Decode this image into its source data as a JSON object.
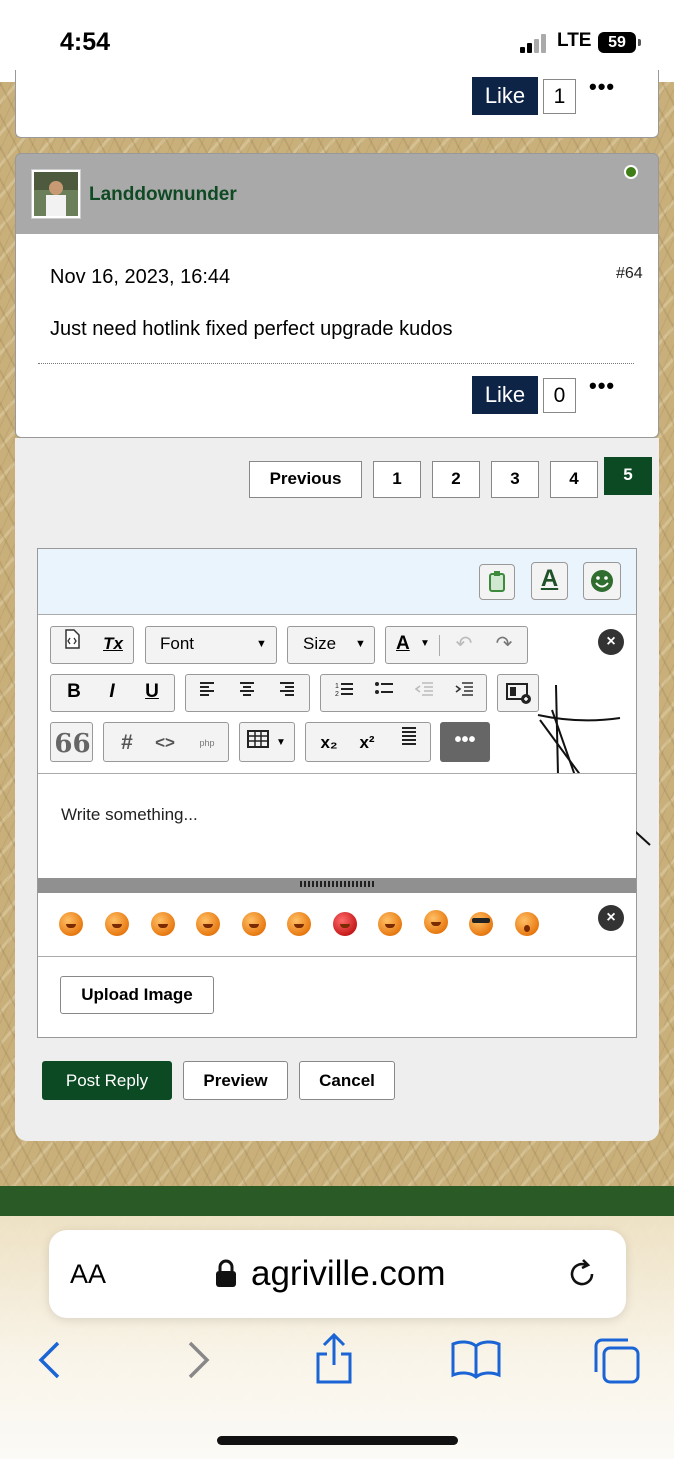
{
  "status_bar": {
    "time": "4:54",
    "network": "LTE",
    "battery": "59"
  },
  "post_top": {
    "like_label": "Like",
    "like_count": "1",
    "more": "•••"
  },
  "post": {
    "username": "Landdownunder",
    "date": "Nov 16, 2023, 16:44",
    "post_number": "#64",
    "body": "Just need hotlink fixed perfect upgrade kudos",
    "like_label": "Like",
    "like_count": "0",
    "more": "•••"
  },
  "pagination": {
    "previous": "Previous",
    "pages": [
      "1",
      "2",
      "3",
      "4",
      "5"
    ],
    "current": "5"
  },
  "editor": {
    "font_label": "Font",
    "size_label": "Size",
    "placeholder": "Write something...",
    "upload_label": "Upload Image",
    "toolbar": {
      "bold": "B",
      "italic": "I",
      "underline": "U",
      "quote": "66",
      "hash": "#",
      "code": "<>",
      "php": "php",
      "subscript": "x₂",
      "superscript": "x²",
      "text_color": "A",
      "clear_format": "Tx"
    }
  },
  "actions": {
    "post_reply": "Post Reply",
    "preview": "Preview",
    "cancel": "Cancel"
  },
  "browser": {
    "aa": "AA",
    "url": "agriville.com"
  },
  "colors": {
    "brand_green": "#0b4a23",
    "like_navy": "#0d2447",
    "online_dot": "#3f7d16",
    "header_gray": "#a9a9a9",
    "editor_blue": "#eaf4fd"
  }
}
